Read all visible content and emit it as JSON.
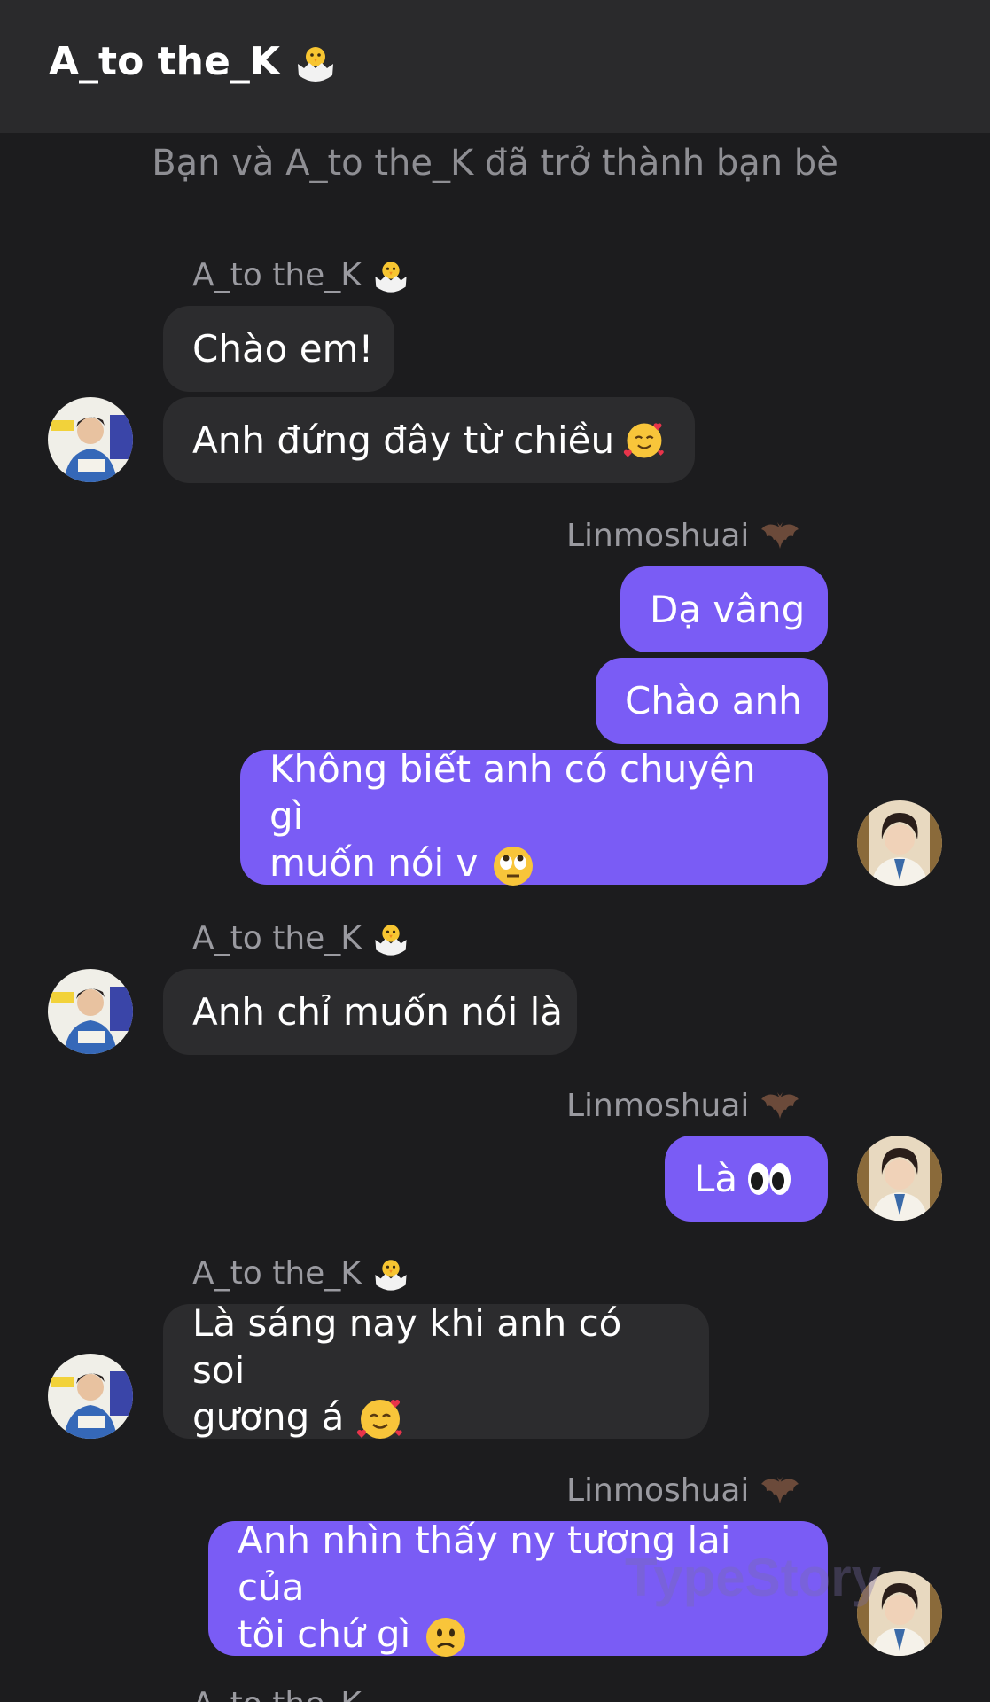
{
  "header": {
    "title": "A_to the_K",
    "title_icon": "hatching-chick-icon"
  },
  "system_message": "Bạn và A_to the_K đã trở thành bạn bè",
  "participants": {
    "them": {
      "name": "A_to the_K",
      "name_icon": "hatching-chick-icon"
    },
    "me": {
      "name": "Linmoshuai",
      "name_icon": "bat-icon"
    }
  },
  "messages": {
    "m1": "Chào em!",
    "m2": "Anh đứng đây từ chiều",
    "m3": "Dạ vâng",
    "m4": "Chào anh",
    "m5_l1": "Không biết anh có chuyện gì",
    "m5_l2": "muốn nói v",
    "m6": "Anh chỉ muốn nói là",
    "m7": "Là",
    "m8_l1": "Là sáng nay khi anh có soi",
    "m8_l2": "gương á",
    "m9_l1": "Anh nhìn thấy ny tương lai của",
    "m9_l2": "tôi chứ gì"
  },
  "message_emojis": {
    "m2": "smiling-face-with-hearts-icon",
    "m5": "eye-roll-face-icon",
    "m7": "eyes-icon",
    "m8": "smiling-face-with-hearts-icon",
    "m9": "slightly-frowning-face-icon"
  },
  "watermark": "TypeStory",
  "colors": {
    "background": "#1c1c1e",
    "header": "#2a2a2c",
    "incoming_bubble": "#2c2c2e",
    "outgoing_bubble": "#7a5cf5",
    "meta_text": "#9a9aa0"
  }
}
